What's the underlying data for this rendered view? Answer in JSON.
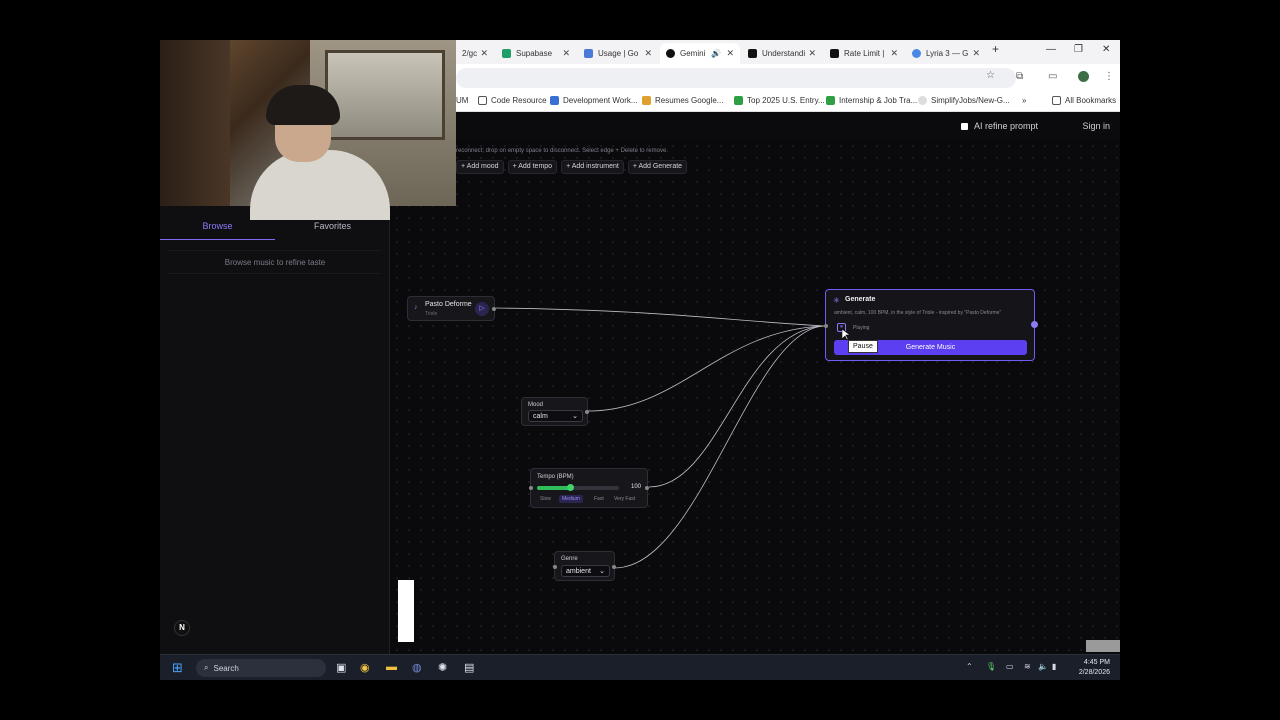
{
  "browser": {
    "tabs": [
      {
        "label": "2/gc",
        "fav_color": "#8a8a8a"
      },
      {
        "label": "Supabase",
        "fav_color": "#1f9e6a"
      },
      {
        "label": "Usage | Go",
        "fav_color": "#4a7ad9"
      },
      {
        "label": "Gemini",
        "fav_color": "#111111"
      },
      {
        "label": "Understandi",
        "fav_color": "#111111"
      },
      {
        "label": "Rate Limit |",
        "fav_color": "#111111"
      },
      {
        "label": "Lyria 3 — G",
        "fav_color": "#4a88e8"
      }
    ],
    "new_tab": "+",
    "bookmarks": [
      {
        "label": "UM",
        "color": "#888888"
      },
      {
        "label": "Code Resource",
        "color": "#555555"
      },
      {
        "label": "Development Work...",
        "color": "#3b6fd4"
      },
      {
        "label": "Resumes Google...",
        "color": "#e0a030"
      },
      {
        "label": "Top 2025 U.S. Entry...",
        "color": "#2ea043"
      },
      {
        "label": "Internship & Job Tra...",
        "color": "#2ea043"
      },
      {
        "label": "SimplifyJobs/New-G...",
        "color": "#cccccc"
      }
    ],
    "bookmarks_more": "»",
    "all_bookmarks": "All Bookmarks"
  },
  "app": {
    "ai_refine_label": "AI refine prompt",
    "sign_in": "Sign in",
    "hint_text": "reconnect; drop on empty space to disconnect. Select edge + Delete to remove.",
    "add_buttons": [
      "+ Add mood",
      "+ Add tempo",
      "+ Add instrument",
      "+ Add Generate"
    ]
  },
  "left_panel": {
    "tab_browse": "Browse",
    "tab_favorites": "Favorites",
    "browse_hint": "Browse music to refine taste",
    "badge": "N"
  },
  "nodes": {
    "track": {
      "title": "Pasto Deforme",
      "subtitle": "Triole"
    },
    "mood": {
      "label": "Mood",
      "value": "calm"
    },
    "tempo": {
      "label": "Tempo (BPM)",
      "value": "100",
      "slider_fraction": 0.4,
      "presets": [
        "Slow",
        "Medium",
        "Fast",
        "Very Fast"
      ],
      "active_preset": "Medium"
    },
    "genre": {
      "label": "Genre",
      "value": "ambient"
    },
    "generate": {
      "title": "Generate",
      "prompt": "ambient, calm, 100 BPM, in the style of Triole - inspired by \"Pasto Deforme\"",
      "status": "Playing",
      "tooltip": "Pause",
      "button": "Generate Music"
    }
  },
  "taskbar": {
    "search": "Search",
    "time": "4:45 PM",
    "date": "2/28/2026"
  },
  "colors": {
    "accent": "#5b3ff0",
    "accent_light": "#8b7cf6"
  }
}
